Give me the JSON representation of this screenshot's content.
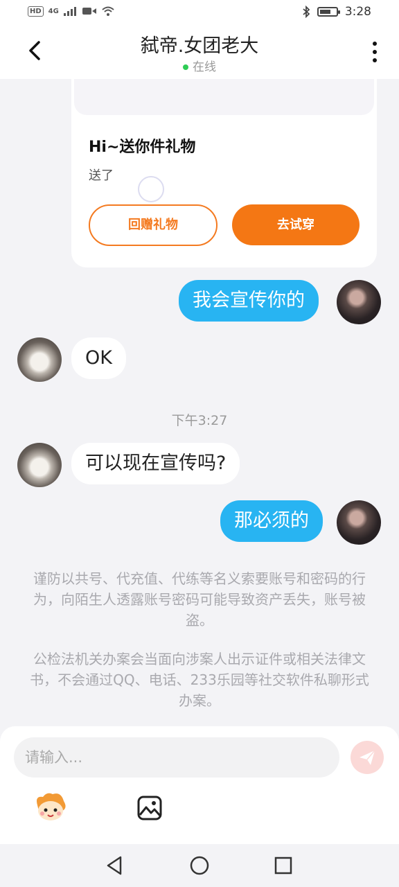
{
  "status_bar": {
    "network_badge": "HD",
    "network_type": "4G",
    "time": "3:28"
  },
  "header": {
    "title": "弑帝.女团老大",
    "status": "在线"
  },
  "gift_card": {
    "title": "Hi~送你件礼物",
    "subtitle": "送了",
    "return_label": "回赠礼物",
    "try_label": "去试穿",
    "accent_color": "#f47714"
  },
  "messages": [
    {
      "sender": "me",
      "text": "我会宣传你的"
    },
    {
      "sender": "them",
      "text": "OK"
    },
    {
      "sender": "them",
      "text": "可以现在宣传吗?"
    },
    {
      "sender": "me",
      "text": "那必须的"
    }
  ],
  "timestamp": "下午3:27",
  "notices": [
    "谨防以共号、代充值、代练等名义索要账号和密码的行为，向陌生人透露账号密码可能导致资产丢失，账号被盗。",
    "公检法机关办案会当面向涉案人出示证件或相关法律文书，不会通过QQ、电话、233乐园等社交软件私聊形式办案。"
  ],
  "composer": {
    "placeholder": "请输入...",
    "send_icon": "send-icon",
    "tools": [
      "emoji-mascot-icon",
      "image-icon"
    ]
  },
  "colors": {
    "my_bubble": "#28b4f2",
    "their_bubble": "#ffffff",
    "online_dot": "#2ecc55",
    "send_disabled": "#fbd9d7"
  }
}
